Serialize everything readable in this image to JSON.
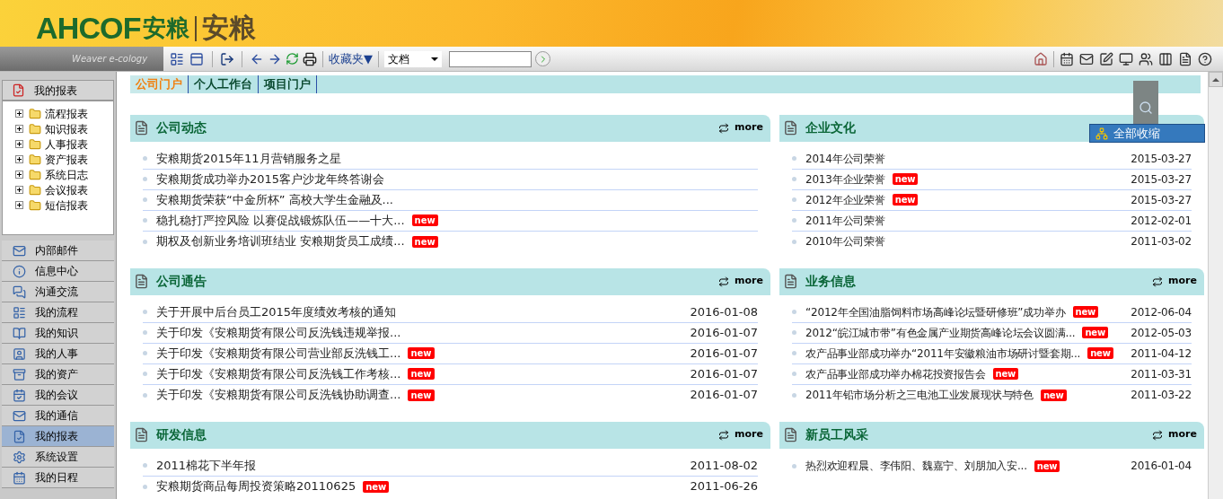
{
  "header": {
    "logo_latin": "AHCOF",
    "logo_cn": "安粮",
    "title": "安粮",
    "subtitle": "Weaver e-cology"
  },
  "toolbar": {
    "favorites": "收藏夹▼",
    "search_type": "文档"
  },
  "sidebar": {
    "title": "我的报表",
    "tree": [
      {
        "label": "流程报表",
        "expanded": false
      },
      {
        "label": "知识报表",
        "expanded": false
      },
      {
        "label": "人事报表",
        "expanded": false
      },
      {
        "label": "资产报表",
        "expanded": false
      },
      {
        "label": "系统日志",
        "expanded": false
      },
      {
        "label": "会议报表",
        "expanded": false
      },
      {
        "label": "短信报表",
        "expanded": false
      }
    ],
    "menu": [
      {
        "label": "内部邮件",
        "selected": false
      },
      {
        "label": "信息中心",
        "selected": false
      },
      {
        "label": "沟通交流",
        "selected": false
      },
      {
        "label": "我的流程",
        "selected": false
      },
      {
        "label": "我的知识",
        "selected": false
      },
      {
        "label": "我的人事",
        "selected": false
      },
      {
        "label": "我的资产",
        "selected": false
      },
      {
        "label": "我的会议",
        "selected": false
      },
      {
        "label": "我的通信",
        "selected": false
      },
      {
        "label": "我的报表",
        "selected": true
      },
      {
        "label": "系统设置",
        "selected": false
      },
      {
        "label": "我的日程",
        "selected": false
      }
    ]
  },
  "tabs": [
    {
      "label": "公司门户",
      "selected": true
    },
    {
      "label": "个人工作台",
      "selected": false
    },
    {
      "label": "项目门户",
      "selected": false
    }
  ],
  "columns": [
    [
      {
        "title": "公司动态",
        "more": "more",
        "rows": [
          {
            "text": "安粮期货2015年11月营销服务之星"
          },
          {
            "text": "安粮期货成功举办2015客户沙龙年终答谢会"
          },
          {
            "text": "安粮期货荣获“中金所杯” 高校大学生金融及..."
          },
          {
            "text": "稳扎稳打严控风险 以赛促战锻炼队伍——十大...",
            "badge": "new"
          },
          {
            "text": "期权及创新业务培训班结业 安粮期货员工成绩...",
            "badge": "new"
          }
        ]
      },
      {
        "title": "公司通告",
        "more": "more",
        "rows": [
          {
            "text": "关于开展中后台员工2015年度绩效考核的通知",
            "date": "2016-01-08"
          },
          {
            "text": "关于印发《安粮期货有限公司反洗钱违规举报...",
            "date": "2016-01-07"
          },
          {
            "text": "关于印发《安粮期货有限公司营业部反洗钱工...",
            "badge": "new",
            "date": "2016-01-07"
          },
          {
            "text": "关于印发《安粮期货有限公司反洗钱工作考核...",
            "badge": "new",
            "date": "2016-01-07"
          },
          {
            "text": "关于印发《安粮期货有限公司反洗钱协助调查...",
            "badge": "new",
            "date": "2016-01-07"
          }
        ]
      },
      {
        "title": "研发信息",
        "more": "more",
        "rows": [
          {
            "text": "2011棉花下半年报",
            "date": "2011-08-02"
          },
          {
            "text": "安粮期货商品每周投资策略20110625",
            "badge": "new",
            "date": "2011-06-26"
          }
        ]
      }
    ],
    [
      {
        "title": "企业文化",
        "rows": [
          {
            "text": "2014年公司荣誉",
            "date": "2015-03-27"
          },
          {
            "text": "2013年企业荣誉",
            "badge": "new",
            "date": "2015-03-27"
          },
          {
            "text": "2012年企业荣誉",
            "badge": "new",
            "date": "2015-03-27"
          },
          {
            "text": "2011年公司荣誉",
            "date": "2012-02-01"
          },
          {
            "text": "2010年公司荣誉",
            "date": "2011-03-02"
          }
        ]
      },
      {
        "title": "业务信息",
        "more": "more",
        "rows": [
          {
            "text": "“2012年全国油脂饲料市场高峰论坛暨研修班”成功举办",
            "badge": "new",
            "date": "2012-06-04"
          },
          {
            "text": "2012“皖江城市带”有色金属产业期货高峰论坛会议圆满...",
            "badge": "new",
            "date": "2012-05-03"
          },
          {
            "text": "农产品事业部成功举办“2011年安徽粮油市场研讨暨套期...",
            "badge": "new",
            "date": "2011-04-12"
          },
          {
            "text": "农产品事业部成功举办棉花投资报告会",
            "badge": "new",
            "date": "2011-03-31"
          },
          {
            "text": "2011年铅市场分析之三电池工业发展现状与特色",
            "badge": "new",
            "date": "2011-03-22"
          }
        ]
      },
      {
        "title": "新员工风采",
        "more": "more",
        "rows": [
          {
            "text": "热烈欢迎程晨、李伟阳、魏嘉宁、刘朋加入安...",
            "badge": "new",
            "date": "2016-01-04"
          }
        ]
      }
    ]
  ],
  "popup_menu": {
    "item": "全部收缩"
  }
}
